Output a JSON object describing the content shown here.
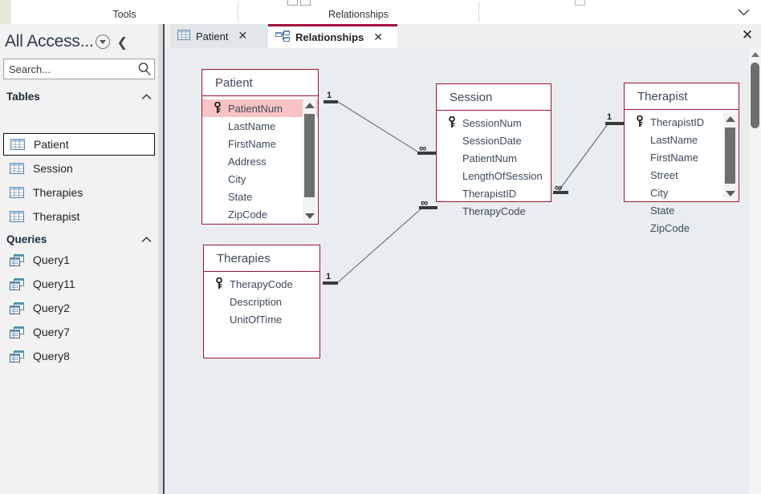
{
  "ribbon": {
    "groups": [
      {
        "label": "Tools"
      },
      {
        "label": "Relationships"
      }
    ],
    "collapse_icon": "chevron-down-icon"
  },
  "navpane": {
    "title": "All Access...",
    "dropdown_icon": "dropdown-arrow-icon",
    "shutter_icon": "chevron-left-icon",
    "search": {
      "value": "Search...",
      "icon": "search-icon"
    },
    "groups": [
      {
        "label": "Tables",
        "chevron": "˄",
        "items": [
          {
            "label": "Patient",
            "icon": "table-icon",
            "selected": true
          },
          {
            "label": "Session",
            "icon": "table-icon",
            "selected": false
          },
          {
            "label": "Therapies",
            "icon": "table-icon",
            "selected": false
          },
          {
            "label": "Therapist",
            "icon": "table-icon",
            "selected": false
          }
        ]
      },
      {
        "label": "Queries",
        "chevron": "˄",
        "items": [
          {
            "label": "Query1",
            "icon": "query-icon",
            "selected": false
          },
          {
            "label": "Query11",
            "icon": "query-icon",
            "selected": false
          },
          {
            "label": "Query2",
            "icon": "query-icon",
            "selected": false
          },
          {
            "label": "Query7",
            "icon": "query-icon",
            "selected": false
          },
          {
            "label": "Query8",
            "icon": "query-icon",
            "selected": false
          }
        ]
      }
    ]
  },
  "tabs": {
    "items": [
      {
        "label": "Patient",
        "icon": "table-icon",
        "active": false,
        "close_icon": "✕"
      },
      {
        "label": "Relationships",
        "icon": "relationships-icon",
        "active": true,
        "close_icon": "✕"
      }
    ],
    "window_close_icon": "✕"
  },
  "diagram": {
    "tables": [
      {
        "name": "Patient",
        "fields": [
          {
            "label": "PatientNum",
            "pk": true,
            "highlight": true
          },
          {
            "label": "LastName",
            "pk": false,
            "highlight": false
          },
          {
            "label": "FirstName",
            "pk": false,
            "highlight": false
          },
          {
            "label": "Address",
            "pk": false,
            "highlight": false
          },
          {
            "label": "City",
            "pk": false,
            "highlight": false
          },
          {
            "label": "State",
            "pk": false,
            "highlight": false
          },
          {
            "label": "ZipCode",
            "pk": false,
            "highlight": false
          }
        ],
        "has_scrollbar": true
      },
      {
        "name": "Session",
        "fields": [
          {
            "label": "SessionNum",
            "pk": true,
            "highlight": false
          },
          {
            "label": "SessionDate",
            "pk": false,
            "highlight": false
          },
          {
            "label": "PatientNum",
            "pk": false,
            "highlight": false
          },
          {
            "label": "LengthOfSession",
            "pk": false,
            "highlight": false
          },
          {
            "label": "TherapistID",
            "pk": false,
            "highlight": false
          },
          {
            "label": "TherapyCode",
            "pk": false,
            "highlight": false
          }
        ],
        "has_scrollbar": false
      },
      {
        "name": "Therapist",
        "fields": [
          {
            "label": "TherapistID",
            "pk": true,
            "highlight": false
          },
          {
            "label": "LastName",
            "pk": false,
            "highlight": false
          },
          {
            "label": "FirstName",
            "pk": false,
            "highlight": false
          },
          {
            "label": "Street",
            "pk": false,
            "highlight": false
          },
          {
            "label": "City",
            "pk": false,
            "highlight": false
          },
          {
            "label": "State",
            "pk": false,
            "highlight": false
          },
          {
            "label": "ZipCode",
            "pk": false,
            "highlight": false
          }
        ],
        "has_scrollbar": true
      },
      {
        "name": "Therapies",
        "fields": [
          {
            "label": "TherapyCode",
            "pk": true,
            "highlight": false
          },
          {
            "label": "Description",
            "pk": false,
            "highlight": false
          },
          {
            "label": "UnitOfTime",
            "pk": false,
            "highlight": false
          }
        ],
        "has_scrollbar": false
      }
    ],
    "relationships": [
      {
        "from": "Patient",
        "to": "Session",
        "from_card": "1",
        "to_card": "∞"
      },
      {
        "from": "Therapies",
        "to": "Session",
        "from_card": "1",
        "to_card": "∞"
      },
      {
        "from": "Therapist",
        "to": "Session",
        "from_card": "1",
        "to_card": "∞"
      }
    ]
  },
  "colors": {
    "accent": "#a4123f",
    "table_border": "#9c1436",
    "highlight_row": "#f8c3c3",
    "canvas_bg": "#e9edf0",
    "nav_bg": "#f2f2f2"
  }
}
